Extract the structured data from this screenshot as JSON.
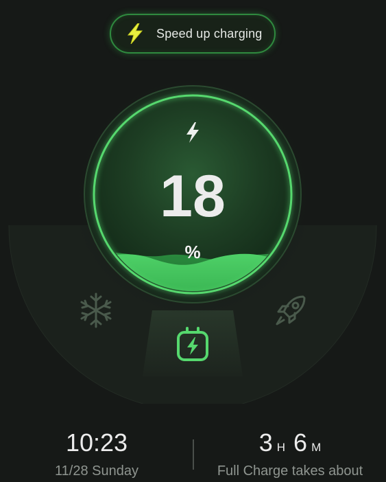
{
  "speed_up": {
    "label": "Speed up charging",
    "icon": "lightning-bolt-icon"
  },
  "battery": {
    "level": 18,
    "unit": "%",
    "level_fraction": 0.18,
    "icon": "charging-bolt-icon"
  },
  "modes": [
    {
      "name": "cooling",
      "icon": "snowflake-icon",
      "active": false
    },
    {
      "name": "charging",
      "icon": "plug-bolt-icon",
      "active": true
    },
    {
      "name": "boost",
      "icon": "rocket-icon",
      "active": false
    }
  ],
  "clock": {
    "time": "10:23",
    "date": "11/28 Sunday"
  },
  "estimate": {
    "hours": "3",
    "hours_unit": "H",
    "minutes": "6",
    "minutes_unit": "M",
    "caption": "Full Charge takes about"
  },
  "colors": {
    "background": "#161917",
    "accent": "#3dc25a",
    "accent_bright": "#56d86e",
    "bolt_yellow": "#e8f040"
  }
}
